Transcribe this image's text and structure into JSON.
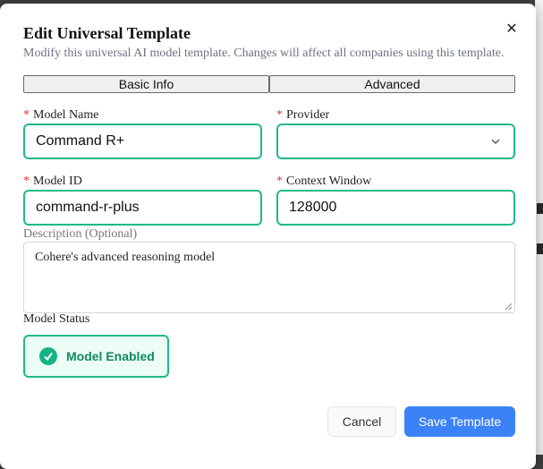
{
  "dialog": {
    "title": "Edit Universal Template",
    "subtitle": "Modify this universal AI model template. Changes will affect all companies using this template.",
    "close_icon": "close-icon"
  },
  "tabs": [
    {
      "label": "Basic Info"
    },
    {
      "label": "Advanced"
    }
  ],
  "form": {
    "required_marker": "*",
    "model_name": {
      "label": "Model Name",
      "value": "Command R+"
    },
    "provider": {
      "label": "Provider",
      "value": ""
    },
    "model_id": {
      "label": "Model ID",
      "value": "command-r-plus"
    },
    "context_window": {
      "label": "Context Window",
      "value": "128000"
    },
    "description": {
      "label": "Description (Optional)",
      "value": "Cohere's advanced reasoning model"
    },
    "status": {
      "label": "Model Status",
      "button_label": "Model Enabled",
      "icon": "check-circle-icon"
    }
  },
  "actions": {
    "cancel_label": "Cancel",
    "save_label": "Save Template"
  },
  "colors": {
    "accent_green": "#1fb98a",
    "primary_blue": "#3b82f6",
    "required_red": "#e53935"
  }
}
